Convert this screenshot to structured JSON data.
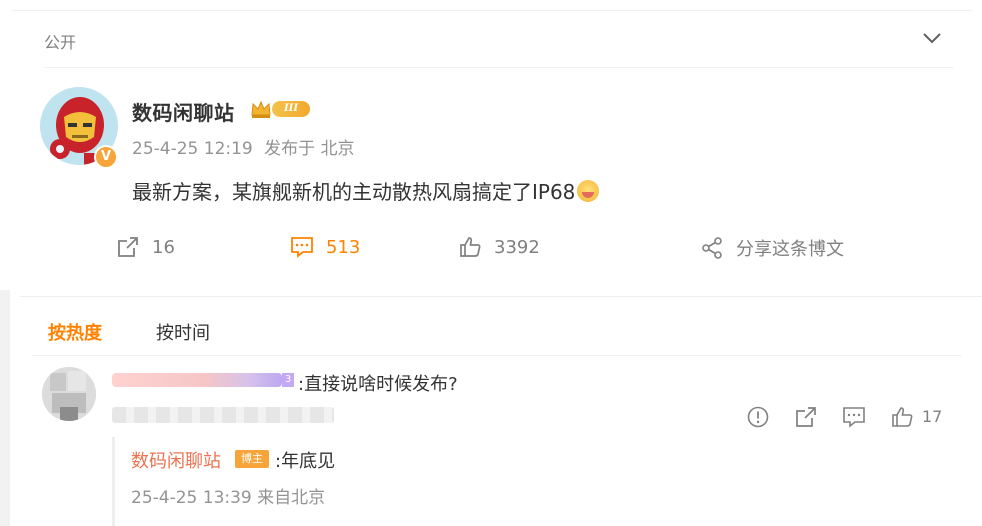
{
  "post": {
    "visibility": "公开",
    "author": "数码闲聊站",
    "level_badge": "III",
    "verified_badge": "V",
    "time": "25-4-25 12:19",
    "source": "发布于 北京",
    "content": "最新方案，某旗舰新机的主动散热风扇搞定了IP68",
    "emoji": "laughing-emoji",
    "actions": {
      "repost_count": "16",
      "comment_count": "513",
      "like_count": "3392",
      "share_label": "分享这条博文"
    },
    "colors": {
      "accent": "#ff8200",
      "author_link": "#eb7350",
      "badge": "#f7a43a"
    }
  },
  "comments": {
    "tabs": {
      "hot": "按热度",
      "time": "按时间"
    },
    "items": [
      {
        "badge_num": "3",
        "text": ":直接说啥时候发布?",
        "like_count": "17",
        "reply": {
          "author": "数码闲聊站",
          "badge": "博主",
          "text": ":年底见",
          "time": "25-4-25 13:39",
          "source": "来自北京"
        }
      }
    ]
  },
  "icons": {
    "collapse": "chevron-down-icon",
    "repost": "repost-icon",
    "comment": "comment-icon",
    "like": "thumbs-up-icon",
    "share": "share-icon",
    "report": "report-icon",
    "reply": "reply-icon"
  }
}
